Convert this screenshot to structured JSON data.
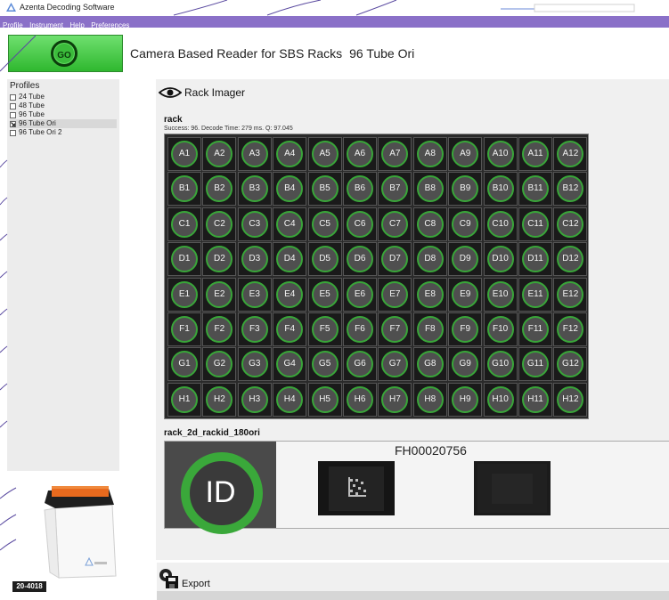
{
  "app": {
    "title": "Azenta Decoding Software"
  },
  "menu": [
    "Profile",
    "Instrument",
    "Help",
    "Preferences"
  ],
  "go_label": "GO",
  "header": {
    "title": "Camera Based Reader for SBS Racks",
    "profile": "96 Tube Ori"
  },
  "profiles": {
    "title": "Profiles",
    "items": [
      {
        "label": "24 Tube",
        "checked": false
      },
      {
        "label": "48 Tube",
        "checked": false
      },
      {
        "label": "96 Tube",
        "checked": false
      },
      {
        "label": "96 Tube Ori",
        "checked": true,
        "selected": true
      },
      {
        "label": "96 Tube Ori 2",
        "checked": false
      }
    ]
  },
  "rack_imager": {
    "title": "Rack Imager",
    "icon": "eye-icon"
  },
  "rack": {
    "name": "rack",
    "status": "Success: 96. Decode Time: 279 ms. Q: 97.045",
    "rows": [
      "A",
      "B",
      "C",
      "D",
      "E",
      "F",
      "G",
      "H"
    ],
    "cols": 12
  },
  "rackid": {
    "name": "rack_2d_rackid_180ori",
    "id_label": "ID",
    "barcode": "FH00020756"
  },
  "export": {
    "title": "Export",
    "icon": "export-icon"
  },
  "device": {
    "part_number": "20-4018"
  },
  "colors": {
    "accent_purple": "#8a70c8",
    "go_green": "#2fb82f",
    "well_ring_green": "#39a639"
  }
}
